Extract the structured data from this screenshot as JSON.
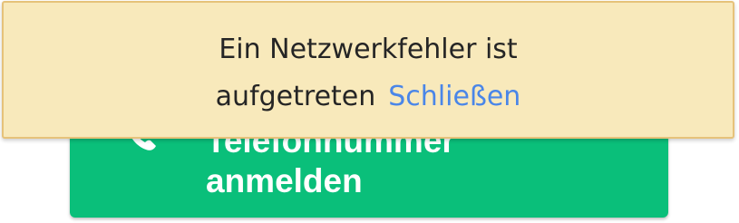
{
  "error_banner": {
    "message_line1": "Ein Netzwerkfehler ist",
    "message_line2": "aufgetreten",
    "dismiss_label": "Schließen",
    "background_color": "#f8e9bb",
    "border_color": "#e6c27a",
    "link_color": "#4a86e8"
  },
  "phone_button": {
    "label_line1": "Telefonnummer",
    "label_line2": "anmelden",
    "icon": "phone-icon",
    "background_color": "#0abf7a",
    "text_color": "#ffffff"
  }
}
